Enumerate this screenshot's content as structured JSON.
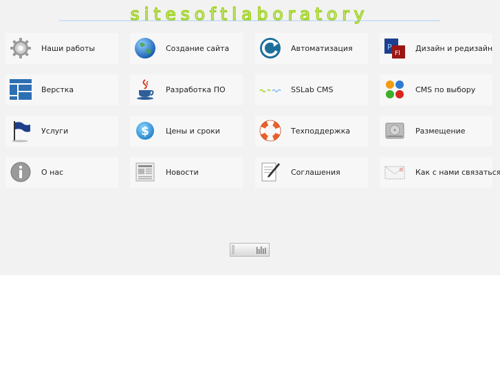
{
  "logo": {
    "text": "sitesoftlaboratory",
    "color": "#9ed21a",
    "accent": "#7fb9ff"
  },
  "menu": [
    {
      "label": "Наши работы",
      "icon": "gear-icon"
    },
    {
      "label": "Создание сайта",
      "icon": "globe-icon"
    },
    {
      "label": "Автоматизация",
      "icon": "refresh-icon"
    },
    {
      "label": "Дизайн и редизайн",
      "icon": "adobe-ps-fl-icon"
    },
    {
      "label": "Верстка",
      "icon": "layout-grid-icon"
    },
    {
      "label": "Разработка ПО",
      "icon": "java-cup-icon"
    },
    {
      "label": "SSLab CMS",
      "icon": "sslab-cms-icon"
    },
    {
      "label": "CMS по выбору",
      "icon": "joomla-icon"
    },
    {
      "label": "Услуги",
      "icon": "flag-icon"
    },
    {
      "label": "Цены и сроки",
      "icon": "dollar-coin-icon"
    },
    {
      "label": "Техподдержка",
      "icon": "lifebuoy-icon"
    },
    {
      "label": "Размещение",
      "icon": "hard-drive-icon"
    },
    {
      "label": "О нас",
      "icon": "info-icon"
    },
    {
      "label": "Новости",
      "icon": "newspaper-icon"
    },
    {
      "label": "Соглашения",
      "icon": "document-pen-icon"
    },
    {
      "label": "Как с нами связаться",
      "icon": "envelope-icon"
    }
  ]
}
